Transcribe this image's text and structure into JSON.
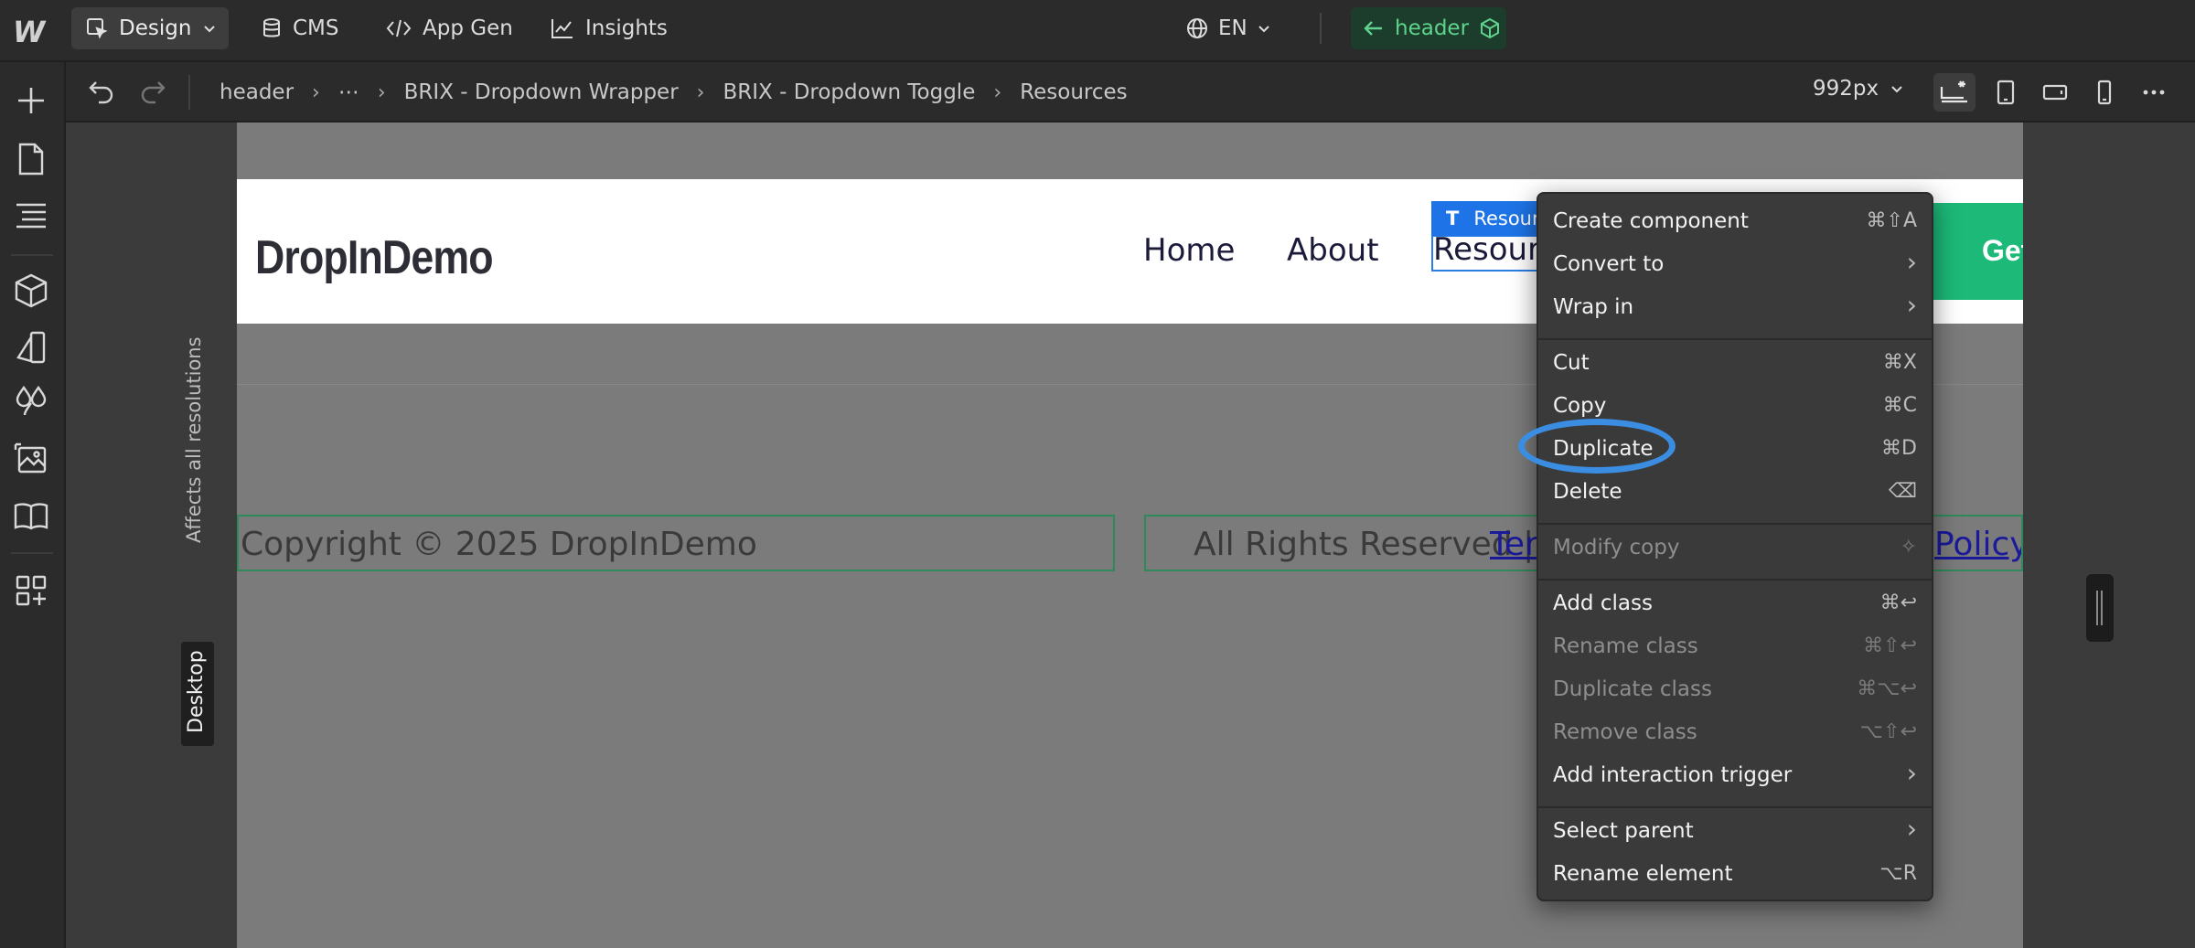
{
  "topbar": {
    "mode_label": "Design",
    "cms_label": "CMS",
    "appgen_label": "App Gen",
    "insights_label": "Insights",
    "language": "EN",
    "component_label": "header"
  },
  "toolbar": {
    "breadcrumbs": [
      "header",
      "⋯",
      "BRIX - Dropdown Wrapper",
      "BRIX - Dropdown Toggle",
      "Resources"
    ],
    "width_value": "992px"
  },
  "canvas": {
    "affects_label": "Affects all resolutions",
    "breakpoint_tag": "Desktop",
    "brand": "DropInDemo",
    "nav_links": [
      "Home",
      "About"
    ],
    "selected_link": "Resources",
    "selected_tag": "Resources",
    "cta_label": "Get Started",
    "footer_copyright": "Copyright © 2025 DropInDemo",
    "footer_rights": "All Rights Reserved |",
    "footer_terms": "Terms",
    "footer_policy": "Policy"
  },
  "context_menu": {
    "items": [
      {
        "label": "Create component",
        "shortcut": "⌘⇧A",
        "disabled": false
      },
      {
        "label": "Convert to",
        "shortcut": "›",
        "disabled": false
      },
      {
        "label": "Wrap in",
        "shortcut": "›",
        "disabled": false
      },
      {
        "label": "Cut",
        "shortcut": "⌘X",
        "disabled": false
      },
      {
        "label": "Copy",
        "shortcut": "⌘C",
        "disabled": false
      },
      {
        "label": "Duplicate",
        "shortcut": "⌘D",
        "disabled": false
      },
      {
        "label": "Delete",
        "shortcut": "⌫",
        "disabled": false
      },
      {
        "label": "Modify copy",
        "shortcut": "✧",
        "disabled": true
      },
      {
        "label": "Add class",
        "shortcut": "⌘↩",
        "disabled": false
      },
      {
        "label": "Rename class",
        "shortcut": "⌘⇧↩",
        "disabled": true
      },
      {
        "label": "Duplicate class",
        "shortcut": "⌘⌥↩",
        "disabled": true
      },
      {
        "label": "Remove class",
        "shortcut": "⌥⇧↩",
        "disabled": true
      },
      {
        "label": "Add interaction trigger",
        "shortcut": "›",
        "disabled": false
      },
      {
        "label": "Select parent",
        "shortcut": "›",
        "disabled": false
      },
      {
        "label": "Rename element",
        "shortcut": "⌥R",
        "disabled": false
      }
    ],
    "highlighted": "Duplicate"
  },
  "colors": {
    "accent_green": "#1db979",
    "selection_blue": "#1e74e6",
    "highlight_ring": "#3a8de0"
  }
}
